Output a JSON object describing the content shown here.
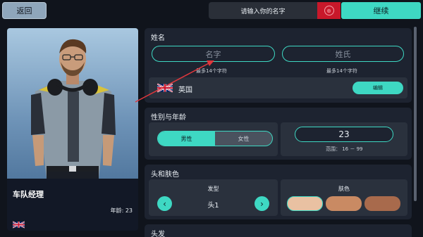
{
  "topbar": {
    "back_label": "返回",
    "name_prompt": "请输入你的名字",
    "continue_label": "继续"
  },
  "portrait": {
    "role": "车队经理",
    "age_text": "年龄: 23"
  },
  "name_section": {
    "title": "姓名",
    "first_name_placeholder": "名字",
    "last_name_placeholder": "姓氏",
    "first_hint": "最多14个字符",
    "last_hint": "最多14个字符",
    "nationality": "英国",
    "edit_label": "编辑"
  },
  "gender_age_section": {
    "title": "性别与年龄",
    "gender_male": "男性",
    "gender_female": "女性",
    "selected_gender": "男性",
    "age_value": "23",
    "age_range": "范围： 16 － 99"
  },
  "head_skin_section": {
    "title": "头和肤色",
    "hairstyle_label": "发型",
    "hairstyle_value": "头1",
    "skin_label": "肤色",
    "skin_colors": [
      "#e9c1a2",
      "#c98a63",
      "#a86a4c"
    ]
  },
  "hair_section": {
    "title": "头发"
  },
  "icons": {
    "prompt": "keyboard-icon",
    "prev": "chevron-left-icon",
    "next": "chevron-right-icon",
    "flag": "uk-flag-icon"
  },
  "colors": {
    "accent": "#3ed8c3",
    "alert": "#c8182a"
  }
}
